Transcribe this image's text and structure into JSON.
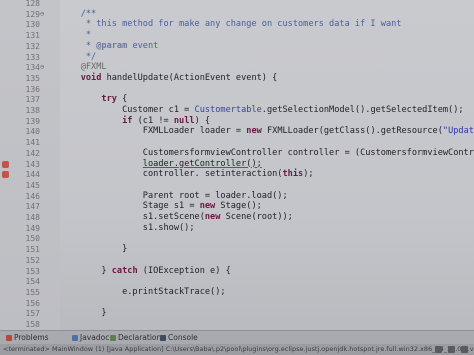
{
  "editor": {
    "lines": [
      {
        "num": "128",
        "fold": "",
        "marker": false,
        "tokens": []
      },
      {
        "num": "129",
        "fold": "⊖",
        "marker": false,
        "tokens": [
          {
            "t": "    /**",
            "c": "cm"
          }
        ]
      },
      {
        "num": "130",
        "fold": "",
        "marker": false,
        "tokens": [
          {
            "t": "     * this method for make any change on customers data if I want",
            "c": "cm"
          }
        ]
      },
      {
        "num": "131",
        "fold": "",
        "marker": false,
        "tokens": [
          {
            "t": "     *",
            "c": "cm"
          }
        ]
      },
      {
        "num": "132",
        "fold": "",
        "marker": false,
        "tokens": [
          {
            "t": "     * ",
            "c": "cm"
          },
          {
            "t": "@param",
            "c": "cmtag"
          },
          {
            "t": " event",
            "c": "cm"
          }
        ]
      },
      {
        "num": "133",
        "fold": "",
        "marker": false,
        "tokens": [
          {
            "t": "     */",
            "c": "cm"
          }
        ]
      },
      {
        "num": "134",
        "fold": "⊖",
        "marker": false,
        "tokens": [
          {
            "t": "    @FXML",
            "c": "ann"
          }
        ]
      },
      {
        "num": "135",
        "fold": "",
        "marker": false,
        "tokens": [
          {
            "t": "    ",
            "c": ""
          },
          {
            "t": "void",
            "c": "kw"
          },
          {
            "t": " handelUpdate(ActionEvent event) {",
            "c": ""
          }
        ]
      },
      {
        "num": "136",
        "fold": "",
        "marker": false,
        "tokens": []
      },
      {
        "num": "137",
        "fold": "",
        "marker": false,
        "tokens": [
          {
            "t": "        ",
            "c": ""
          },
          {
            "t": "try",
            "c": "kw"
          },
          {
            "t": " {",
            "c": ""
          }
        ]
      },
      {
        "num": "138",
        "fold": "",
        "marker": false,
        "tokens": [
          {
            "t": "            Customer c1 = ",
            "c": ""
          },
          {
            "t": "Customertable",
            "c": "fld"
          },
          {
            "t": ".getSelectionModel().getSelectedItem();",
            "c": ""
          }
        ]
      },
      {
        "num": "139",
        "fold": "",
        "marker": false,
        "tokens": [
          {
            "t": "            ",
            "c": ""
          },
          {
            "t": "if",
            "c": "kw"
          },
          {
            "t": " (c1 != ",
            "c": ""
          },
          {
            "t": "null",
            "c": "kw"
          },
          {
            "t": ") {",
            "c": ""
          }
        ]
      },
      {
        "num": "140",
        "fold": "",
        "marker": false,
        "tokens": [
          {
            "t": "                FXMLLoader loader = ",
            "c": ""
          },
          {
            "t": "new",
            "c": "kw"
          },
          {
            "t": " FXMLLoader(getClass().getResource(",
            "c": ""
          },
          {
            "t": "\"UpdateCustomer.fxml\"",
            "c": "str"
          },
          {
            "t": "));",
            "c": ""
          }
        ]
      },
      {
        "num": "141",
        "fold": "",
        "marker": false,
        "tokens": []
      },
      {
        "num": "142",
        "fold": "",
        "marker": false,
        "tokens": [
          {
            "t": "                CustomersformviewController controller = (CustomersformviewController)",
            "c": ""
          }
        ]
      },
      {
        "num": "143",
        "fold": "",
        "marker": true,
        "tokens": [
          {
            "t": "                ",
            "c": ""
          },
          {
            "t": "loader.getController();",
            "c": "ul"
          }
        ]
      },
      {
        "num": "144",
        "fold": "",
        "marker": true,
        "tokens": [
          {
            "t": "                controller. setinteraction(",
            "c": ""
          },
          {
            "t": "this",
            "c": "kw"
          },
          {
            "t": ");",
            "c": ""
          }
        ]
      },
      {
        "num": "145",
        "fold": "",
        "marker": false,
        "tokens": []
      },
      {
        "num": "146",
        "fold": "",
        "marker": false,
        "tokens": [
          {
            "t": "                Parent root = loader.load();",
            "c": ""
          }
        ]
      },
      {
        "num": "147",
        "fold": "",
        "marker": false,
        "tokens": [
          {
            "t": "                Stage s1 = ",
            "c": ""
          },
          {
            "t": "new",
            "c": "kw"
          },
          {
            "t": " Stage();",
            "c": ""
          }
        ]
      },
      {
        "num": "148",
        "fold": "",
        "marker": false,
        "tokens": [
          {
            "t": "                s1.setScene(",
            "c": ""
          },
          {
            "t": "new",
            "c": "kw"
          },
          {
            "t": " Scene(root));",
            "c": ""
          }
        ]
      },
      {
        "num": "149",
        "fold": "",
        "marker": false,
        "tokens": [
          {
            "t": "                s1.show();",
            "c": ""
          }
        ]
      },
      {
        "num": "150",
        "fold": "",
        "marker": false,
        "tokens": []
      },
      {
        "num": "151",
        "fold": "",
        "marker": false,
        "tokens": [
          {
            "t": "            }",
            "c": ""
          }
        ]
      },
      {
        "num": "152",
        "fold": "",
        "marker": false,
        "tokens": []
      },
      {
        "num": "153",
        "fold": "",
        "marker": false,
        "tokens": [
          {
            "t": "        } ",
            "c": ""
          },
          {
            "t": "catch",
            "c": "kw"
          },
          {
            "t": " (IOException e) {",
            "c": ""
          }
        ]
      },
      {
        "num": "154",
        "fold": "",
        "marker": false,
        "tokens": []
      },
      {
        "num": "155",
        "fold": "",
        "marker": false,
        "tokens": [
          {
            "t": "            e.printStackTrace();",
            "c": ""
          }
        ]
      },
      {
        "num": "156",
        "fold": "",
        "marker": false,
        "tokens": []
      },
      {
        "num": "157",
        "fold": "",
        "marker": false,
        "tokens": [
          {
            "t": "        }",
            "c": ""
          }
        ]
      },
      {
        "num": "158",
        "fold": "",
        "marker": false,
        "tokens": []
      },
      {
        "num": "159",
        "fold": "",
        "marker": false,
        "tokens": [
          {
            "t": "    }",
            "c": ""
          }
        ]
      }
    ]
  },
  "bottom_tabs": [
    {
      "label": "Problems",
      "icon_name": "problems-icon",
      "color": "#b8473a"
    },
    {
      "label": "Javadoc",
      "icon_name": "javadoc-icon",
      "color": "#4f6fa8"
    },
    {
      "label": "Declaration",
      "icon_name": "declaration-icon",
      "color": "#5d7d53"
    },
    {
      "label": "Console",
      "icon_name": "console-icon",
      "color": "#3f4a5c"
    }
  ],
  "status_bar": {
    "text": "<terminated> MainWindow (1) [Java Application] C:\\Users\\Baba\\.p2\\pool\\plugins\\org.eclipse.justj.openjdk.hotspot.jre.full.win32.x86_64_16.0.2.v2021"
  }
}
